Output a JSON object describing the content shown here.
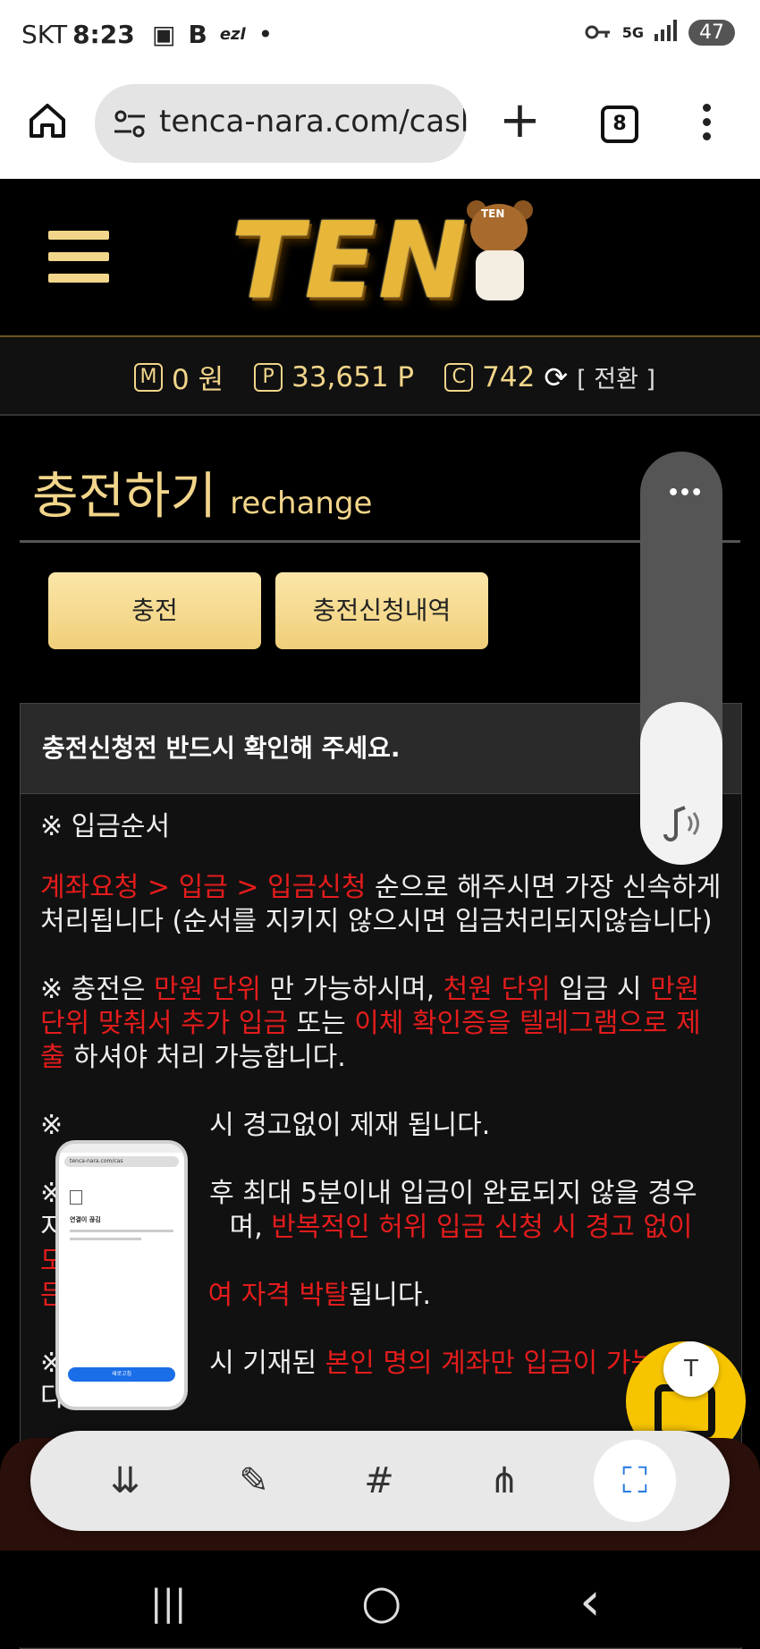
{
  "status_bar": {
    "carrier": "SKT",
    "time": "8:23",
    "left_icons": [
      "screenshot-icon",
      "b-icon",
      "ezl-icon",
      "dot-icon"
    ],
    "left_icon_text": [
      "▣",
      "B",
      "ezl",
      "•"
    ],
    "right_icons": [
      "key-icon",
      "5g-icon",
      "signal-icon",
      "battery-icon"
    ],
    "battery": "47"
  },
  "browser": {
    "url": "tenca-nara.com/casl",
    "tab_count": "8",
    "plus_label": "+"
  },
  "site": {
    "logo_text": "TEN",
    "bear_label": "TEN",
    "points": {
      "m_label": "M",
      "m_value": "0 원",
      "p_label": "P",
      "p_value": "33,651 P",
      "c_label": "C",
      "c_value": "742",
      "refresh": "⟳",
      "switch_label": "[ 전환 ]"
    },
    "page_title": "충전하기",
    "page_subtitle": "rechange",
    "buttons": {
      "charge": "충전",
      "history": "충전신청내역"
    },
    "notice": {
      "heading": "충전신청전 반드시 확인해 주세요.",
      "sec1_title": "※ 입금순서",
      "sec1_red": "계좌요청 > 입금 > 입금신청",
      "sec1_text": " 순으로 해주시면 가장 신속하게 처리됩니다 (순서를 지키지 않으시면 입금처리되지않습니다)",
      "sec2_a": "※ 충전은 ",
      "sec2_b": "만원 단위",
      "sec2_c": " 만 가능하시며, ",
      "sec2_d": "천원 단위",
      "sec2_e": " 입금 시 ",
      "sec2_f": "만원 단위 맞춰서 추가 입금",
      "sec2_g": " 또는 ",
      "sec2_h": "이체 확인증을 텔레그램으로 제출",
      "sec2_i": " 하셔야 처리 가능합니다.",
      "sec3_a": "※",
      "sec3_b": "시 경고없이 제재 됩니다.",
      "sec4_a": "※",
      "sec4_b": "후 최대 5분이내 입금이 완료되지 않을 경우",
      "sec4_c": "지",
      "sec4_d": "며, ",
      "sec4_e": "반복적인 허위 입금 신청 시 경고 없이 모",
      "sec4_f": "든",
      "sec4_g": "여 자격 박탈",
      "sec4_h": "됩니다.",
      "sec5_a": "※",
      "sec5_b": "시 기재된 ",
      "sec5_c": "본인 명의 계좌만 입금이 가능",
      "sec5_d": "다"
    }
  },
  "overlay": {
    "slider_dots": "•••",
    "mini_phone_url": "tenca-nara.com/cas",
    "mini_phone_title": "연결이 끊김",
    "mini_phone_button": "새로고침",
    "scan_text_icon": "T"
  },
  "toolbar": {
    "icons": [
      "scroll-capture-icon",
      "draw-icon",
      "hashtag-icon",
      "share-icon",
      "crop-icon"
    ],
    "glyphs": [
      "⇊",
      "✎",
      "#",
      "⋔",
      "⛶"
    ]
  },
  "nav": {
    "recents": "|||",
    "home": "○",
    "back": "‹"
  }
}
